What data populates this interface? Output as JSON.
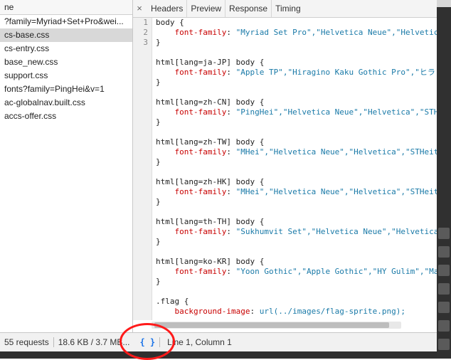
{
  "left_panel": {
    "header": "ne",
    "files": [
      "?family=Myriad+Set+Pro&wei...",
      "cs-base.css",
      "cs-entry.css",
      "base_new.css",
      "support.css",
      "fonts?family=PingHei&v=1",
      "ac-globalnav.built.css",
      "accs-offer.css"
    ],
    "selected_index": 1
  },
  "tabs": {
    "close": "×",
    "items": [
      "Headers",
      "Preview",
      "Response",
      "Timing"
    ]
  },
  "code": {
    "line_numbers": [
      "1",
      "2",
      "3"
    ],
    "lines": [
      {
        "kind": "sel",
        "text": "body {"
      },
      {
        "kind": "decl",
        "prop": "font-family",
        "value": "\"Myriad Set Pro\",\"Helvetica Neue\",\"Helvetic"
      },
      {
        "kind": "sel",
        "text": "}"
      },
      {
        "kind": "blank",
        "text": ""
      },
      {
        "kind": "sel",
        "text": "html[lang=ja-JP] body {"
      },
      {
        "kind": "decl",
        "prop": "font-family",
        "value": "\"Apple TP\",\"Hiragino Kaku Gothic Pro\",\"ヒラ"
      },
      {
        "kind": "sel",
        "text": "}"
      },
      {
        "kind": "blank",
        "text": ""
      },
      {
        "kind": "sel",
        "text": "html[lang=zh-CN] body {"
      },
      {
        "kind": "decl",
        "prop": "font-family",
        "value": "\"PingHei\",\"Helvetica Neue\",\"Helvetica\",\"STH"
      },
      {
        "kind": "sel",
        "text": "}"
      },
      {
        "kind": "blank",
        "text": ""
      },
      {
        "kind": "sel",
        "text": "html[lang=zh-TW] body {"
      },
      {
        "kind": "decl",
        "prop": "font-family",
        "value": "\"MHei\",\"Helvetica Neue\",\"Helvetica\",\"STHeit"
      },
      {
        "kind": "sel",
        "text": "}"
      },
      {
        "kind": "blank",
        "text": ""
      },
      {
        "kind": "sel",
        "text": "html[lang=zh-HK] body {"
      },
      {
        "kind": "decl",
        "prop": "font-family",
        "value": "\"MHei\",\"Helvetica Neue\",\"Helvetica\",\"STHeit"
      },
      {
        "kind": "sel",
        "text": "}"
      },
      {
        "kind": "blank",
        "text": ""
      },
      {
        "kind": "sel",
        "text": "html[lang=th-TH] body {"
      },
      {
        "kind": "decl",
        "prop": "font-family",
        "value": "\"Sukhumvit Set\",\"Helvetica Neue\",\"Helvetica"
      },
      {
        "kind": "sel",
        "text": "}"
      },
      {
        "kind": "blank",
        "text": ""
      },
      {
        "kind": "sel",
        "text": "html[lang=ko-KR] body {"
      },
      {
        "kind": "decl",
        "prop": "font-family",
        "value": "\"Yoon Gothic\",\"Apple Gothic\",\"HY Gulim\",\"Ma"
      },
      {
        "kind": "sel",
        "text": "}"
      },
      {
        "kind": "blank",
        "text": ""
      },
      {
        "kind": "sel",
        "text": ".flag {"
      },
      {
        "kind": "decl",
        "prop": "background-image",
        "value": "url(../images/flag-sprite.png);"
      }
    ]
  },
  "status": {
    "requests": "55 requests",
    "size": "18.6 KB / 3.7 MB...",
    "pretty_print": "{ }",
    "cursor_position": "Line 1, Column 1"
  }
}
